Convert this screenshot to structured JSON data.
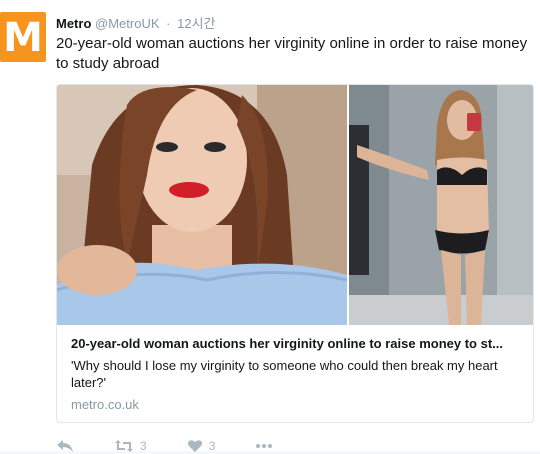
{
  "tweet": {
    "avatar_letter": "M",
    "author_name": "Metro",
    "handle": "@MetroUK",
    "separator": "·",
    "time": "12시간",
    "text": "20-year-old woman auctions her virginity online in order to raise money to study abroad",
    "card": {
      "title": "20-year-old woman auctions her virginity online to raise money to st...",
      "description": "'Why should I lose my virginity to someone who could then break my heart later?'",
      "domain": "metro.co.uk",
      "images": [
        "portrait-photo",
        "mirror-selfie-photo"
      ]
    },
    "actions": {
      "reply_icon": "reply-icon",
      "retweet_icon": "retweet-icon",
      "retweet_count": "3",
      "like_icon": "heart-icon",
      "like_count": "3",
      "more_icon": "more-icon"
    }
  },
  "colors": {
    "brand_orange": "#f7941e",
    "text": "#14171a",
    "muted": "#8899a6",
    "border": "#e1e8ed"
  }
}
